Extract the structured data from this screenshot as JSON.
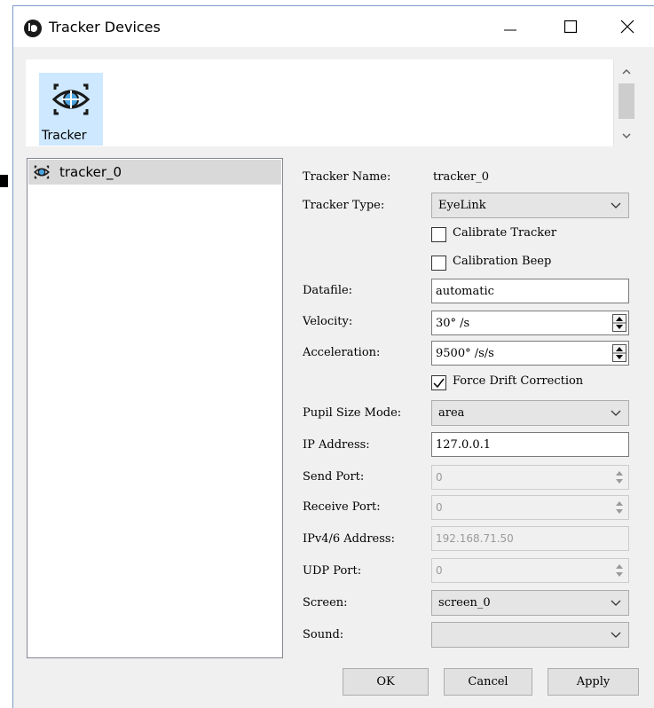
{
  "window": {
    "title": "Tracker Devices"
  },
  "device_bar": {
    "items": [
      {
        "label": "Tracker",
        "icon": "eye-tracker-icon",
        "selected": true
      }
    ]
  },
  "tree": {
    "items": [
      {
        "label": "tracker_0",
        "icon": "eye-tracker-icon",
        "selected": true
      }
    ]
  },
  "form": {
    "tracker_name": {
      "label": "Tracker Name:",
      "value": "tracker_0"
    },
    "tracker_type": {
      "label": "Tracker Type:",
      "value": "EyeLink"
    },
    "calibrate_tracker": {
      "label": "Calibrate Tracker",
      "checked": false
    },
    "calibration_beep": {
      "label": "Calibration Beep",
      "checked": false
    },
    "datafile": {
      "label": "Datafile:",
      "value": "automatic"
    },
    "velocity": {
      "label": "Velocity:",
      "value": "30° /s"
    },
    "acceleration": {
      "label": "Acceleration:",
      "value": "9500° /s/s"
    },
    "force_drift_correction": {
      "label": "Force Drift Correction",
      "checked": true
    },
    "pupil_size_mode": {
      "label": "Pupil Size Mode:",
      "value": "area"
    },
    "ip_address": {
      "label": "IP Address:",
      "value": "127.0.0.1"
    },
    "send_port": {
      "label": "Send Port:",
      "value": "0",
      "enabled": false
    },
    "receive_port": {
      "label": "Receive Port:",
      "value": "0",
      "enabled": false
    },
    "ipv46_address": {
      "label": "IPv4/6 Address:",
      "value": "192.168.71.50",
      "enabled": false
    },
    "udp_port": {
      "label": "UDP Port:",
      "value": "0",
      "enabled": false
    },
    "screen": {
      "label": "Screen:",
      "value": "screen_0"
    },
    "sound": {
      "label": "Sound:",
      "value": ""
    }
  },
  "buttons": {
    "ok": "OK",
    "cancel": "Cancel",
    "apply": "Apply"
  },
  "colors": {
    "selection": "#cde8ff",
    "tree_selection": "#d9d9d9",
    "window_bg": "#f0f0f0"
  }
}
